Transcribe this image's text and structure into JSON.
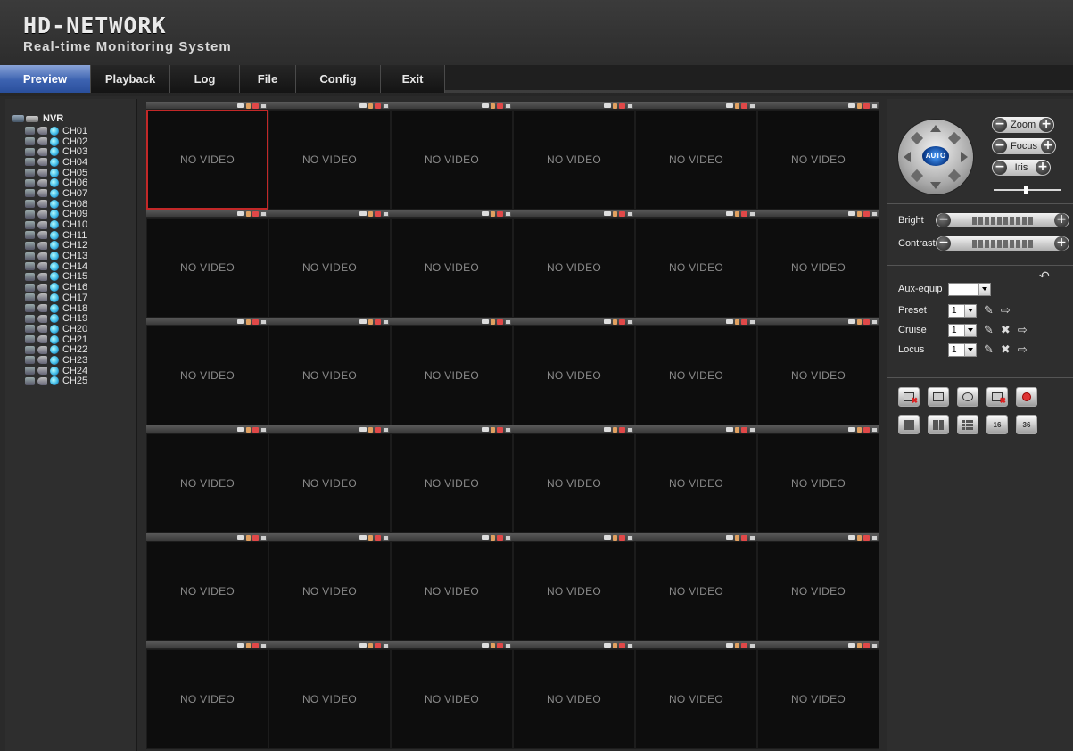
{
  "brand": {
    "title": "HD-NETWORK",
    "subtitle": "Real-time Monitoring System"
  },
  "nav": {
    "tabs": [
      "Preview",
      "Playback",
      "Log",
      "File",
      "Config",
      "Exit"
    ],
    "active": "Preview"
  },
  "tree": {
    "root": "NVR",
    "channels": [
      "CH01",
      "CH02",
      "CH03",
      "CH04",
      "CH05",
      "CH06",
      "CH07",
      "CH08",
      "CH09",
      "CH10",
      "CH11",
      "CH12",
      "CH13",
      "CH14",
      "CH15",
      "CH16",
      "CH17",
      "CH18",
      "CH19",
      "CH20",
      "CH21",
      "CH22",
      "CH23",
      "CH24",
      "CH25"
    ]
  },
  "grid": {
    "rows": 6,
    "cols": 6,
    "cell_text": "NO VIDEO",
    "selected_cell": 0
  },
  "ptz": {
    "auto_label": "AUTO",
    "zoom_label": "Zoom",
    "focus_label": "Focus",
    "iris_label": "Iris"
  },
  "image_adjust": {
    "bright_label": "Bright",
    "contrast_label": "Contrast"
  },
  "aux": {
    "aux_equip_label": "Aux-equip",
    "preset_label": "Preset",
    "preset_value": "1",
    "cruise_label": "Cruise",
    "cruise_value": "1",
    "locus_label": "Locus",
    "locus_value": "1"
  },
  "layout_buttons": {
    "split16_label": "16",
    "split36_label": "36"
  },
  "colors": {
    "active_tab": "#3c62b0",
    "selected_cell_border": "#c22828",
    "channel_icon": "#3ab7e6"
  }
}
